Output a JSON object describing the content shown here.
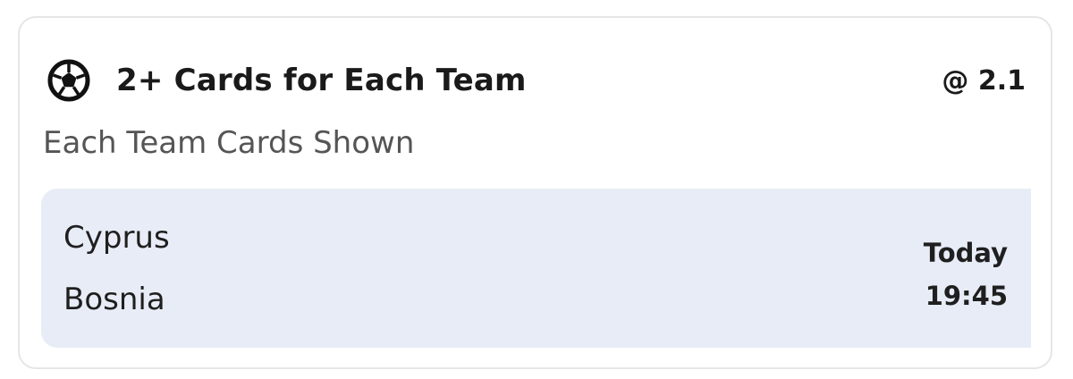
{
  "market": {
    "icon": "soccer-ball-icon",
    "title": "2+ Cards for Each Team",
    "odds": "@ 2.1",
    "subtitle": "Each Team Cards Shown"
  },
  "event": {
    "teams": [
      "Cyprus",
      "Bosnia"
    ],
    "day": "Today",
    "time": "19:45",
    "background_color": "#e8ecf7"
  }
}
